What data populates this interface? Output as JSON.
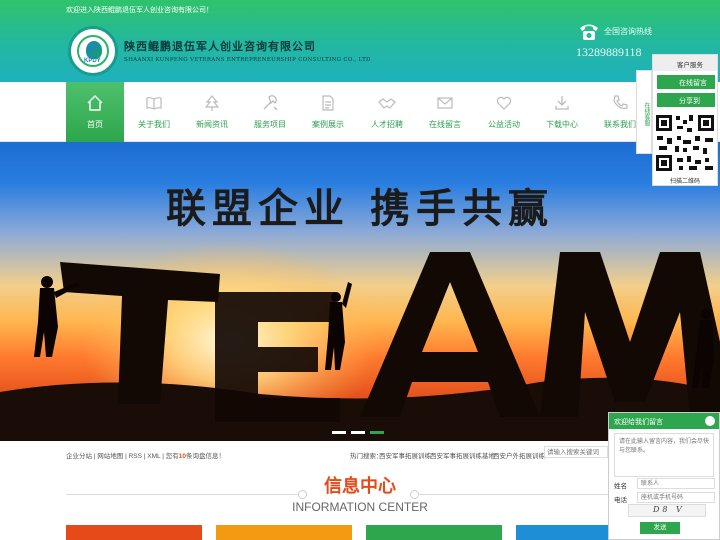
{
  "header": {
    "welcome": "欢迎进入陕西鲲鹏退伍军人创业咨询有限公司！",
    "logo_abbr": "KPDY",
    "company_name_zh": "陕西鲲鹏退伍军人创业咨询有限公司",
    "company_name_en": "SHAANXI KUNPENG VETERANS ENTREPRENEURSHIP CONSULTING CO., LTD",
    "hotline_label": "全国咨询热线",
    "hotline_number": "13289889118"
  },
  "nav": {
    "items": [
      {
        "label": "首页",
        "icon": "home-icon"
      },
      {
        "label": "关于我们",
        "icon": "book-icon"
      },
      {
        "label": "新闻资讯",
        "icon": "tree-icon"
      },
      {
        "label": "服务项目",
        "icon": "tools-icon"
      },
      {
        "label": "案例展示",
        "icon": "document-icon"
      },
      {
        "label": "人才招聘",
        "icon": "handshake-icon"
      },
      {
        "label": "在线留言",
        "icon": "mail-icon"
      },
      {
        "label": "公益活动",
        "icon": "heart-icon"
      },
      {
        "label": "下载中心",
        "icon": "download-icon"
      },
      {
        "label": "联系我们",
        "icon": "phone-icon"
      }
    ]
  },
  "banner": {
    "slogan": "联盟企业 携手共赢",
    "team_word": "TEAM"
  },
  "strip": {
    "links": "企业分站 | 网站地图 | RSS | XML | 您有",
    "count": "10",
    "links_suffix": "条询盘信息！",
    "hot_label": "热门搜索：",
    "hot_links": [
      "西安军事拓展训练",
      "西安军事拓展训练基地",
      "西安户外拓展训练"
    ],
    "search_placeholder": "请输入搜索关键词"
  },
  "info_center": {
    "title": "信息中心",
    "subtitle": "INFORMATION CENTER"
  },
  "float": {
    "tab": "在线客服",
    "service_head": "客户服务",
    "btn_message": "在线留言",
    "btn_share": "分享到",
    "qr_label": "扫描二维码"
  },
  "message_box": {
    "title": "欢迎给我们留言",
    "textarea_placeholder": "请在此输入留言内容，我们会尽快与您联系。",
    "name_label": "姓名",
    "name_placeholder": "联系人",
    "phone_label": "电话",
    "phone_placeholder": "座机或手机号码",
    "captcha": "D8 V",
    "send": "发送"
  },
  "colors": {
    "brand_green": "#2ea64d",
    "accent_orange": "#e64a19"
  }
}
